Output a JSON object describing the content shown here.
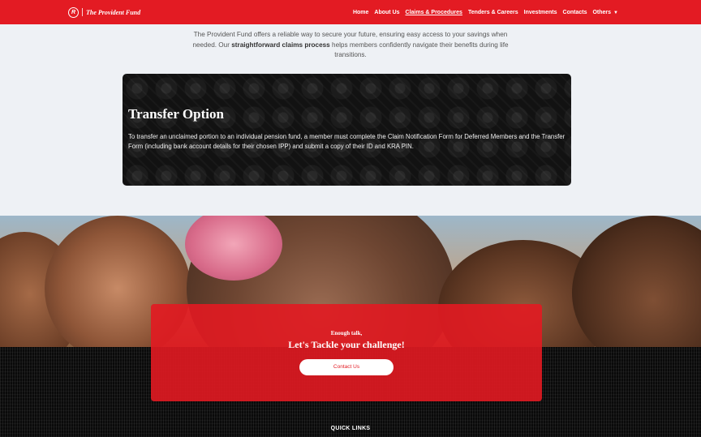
{
  "brand": {
    "logo_mark": "R",
    "name": "The Provident Fund"
  },
  "nav": {
    "items": [
      "Home",
      "About Us",
      "Claims & Procedures",
      "Tenders & Careers",
      "Investments",
      "Contacts",
      "Others"
    ],
    "active_index": 2
  },
  "intro": {
    "before": "The Provident Fund offers a reliable way to secure your future, ensuring easy access to your savings when needed. Our ",
    "bold": "straightforward claims process",
    "after": " helps members confidently navigate their benefits during life transitions."
  },
  "transfer_card": {
    "title": "Transfer Option",
    "body": "To transfer an unclaimed portion to an individual pension fund, a member must complete the Claim Notification Form for Deferred Members and the Transfer Form (including bank account details for their chosen IPP) and submit a copy of their ID and KRA PIN."
  },
  "cta": {
    "eyebrow": "Enough talk,",
    "headline": "Let's Tackle your challenge!",
    "button": "Contact Us"
  },
  "footer": {
    "quick_links_title": "QUICK LINKS"
  },
  "colors": {
    "brand_red": "#e31b23",
    "card_bg": "#121212",
    "page_bg": "#eef1f5"
  }
}
